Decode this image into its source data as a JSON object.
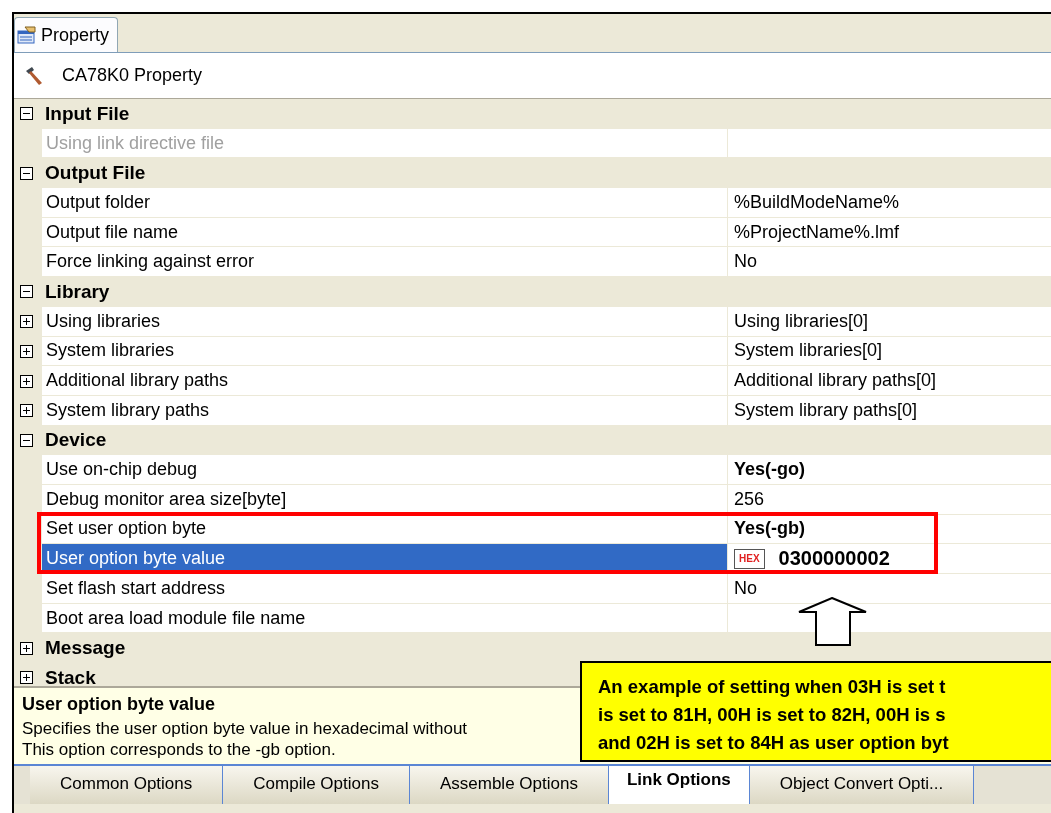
{
  "top_tabs": [
    {
      "label": "Property",
      "selected": true
    }
  ],
  "header": {
    "title": "CA78K0 Property"
  },
  "categories": [
    {
      "name": "Input File",
      "expanded": true,
      "items": [
        {
          "name": "Using link directive file",
          "value": "",
          "disabled": true,
          "selected": false
        }
      ]
    },
    {
      "name": "Output File",
      "expanded": true,
      "items": [
        {
          "name": "Output folder",
          "value": "%BuildModeName%",
          "disabled": false,
          "selected": false,
          "modified": false
        },
        {
          "name": "Output file name",
          "value": "%ProjectName%.lmf",
          "disabled": false,
          "selected": false,
          "modified": false
        },
        {
          "name": "Force linking against error",
          "value": "No",
          "disabled": false,
          "selected": false,
          "modified": false
        }
      ]
    },
    {
      "name": "Library",
      "expanded": true,
      "items": [
        {
          "name": "Using libraries",
          "value": "Using libraries[0]",
          "disabled": false,
          "selected": false,
          "modified": false,
          "expanded": false
        },
        {
          "name": "System libraries",
          "value": "System libraries[0]",
          "disabled": false,
          "selected": false,
          "modified": false,
          "expanded": false
        },
        {
          "name": "Additional library paths",
          "value": "Additional library paths[0]",
          "disabled": false,
          "selected": false,
          "modified": false,
          "expanded": false
        },
        {
          "name": "System library paths",
          "value": "System library paths[0]",
          "disabled": false,
          "selected": false,
          "modified": false,
          "expanded": false
        }
      ]
    },
    {
      "name": "Device",
      "expanded": true,
      "items": [
        {
          "name": "Use on-chip debug",
          "value": "Yes(-go)",
          "disabled": false,
          "selected": false,
          "modified": true
        },
        {
          "name": "Debug monitor area size[byte]",
          "value": "256",
          "disabled": false,
          "selected": false,
          "modified": false
        },
        {
          "name": "Set user option byte",
          "value": "Yes(-gb)",
          "disabled": false,
          "selected": false,
          "modified": true
        },
        {
          "name": "User option byte value",
          "value": "0300000002",
          "badge": "HEX",
          "disabled": false,
          "selected": true,
          "modified": true
        },
        {
          "name": "Set flash start address",
          "value": "No",
          "disabled": false,
          "selected": false,
          "modified": false
        },
        {
          "name": "Boot area load module file name",
          "value": "",
          "disabled": false,
          "selected": false
        }
      ]
    },
    {
      "name": "Message",
      "expanded": false
    },
    {
      "name": "Stack",
      "expanded": false
    }
  ],
  "description": {
    "title": "User option byte value",
    "lines": [
      "Specifies the user option byte value in hexadecimal without",
      "This option corresponds to the -gb option."
    ]
  },
  "bottom_tabs": [
    {
      "label": "Common Options",
      "selected": false
    },
    {
      "label": "Compile Options",
      "selected": false
    },
    {
      "label": "Assemble Options",
      "selected": false
    },
    {
      "label": "Link Options",
      "selected": true
    },
    {
      "label": "Object Convert Opti...",
      "selected": false
    }
  ],
  "callout": {
    "lines": [
      "An example of setting when 03H is set t",
      "is set to 81H, 00H is set to 82H, 00H is s",
      "and 02H is set to 84H as user option byt"
    ]
  }
}
